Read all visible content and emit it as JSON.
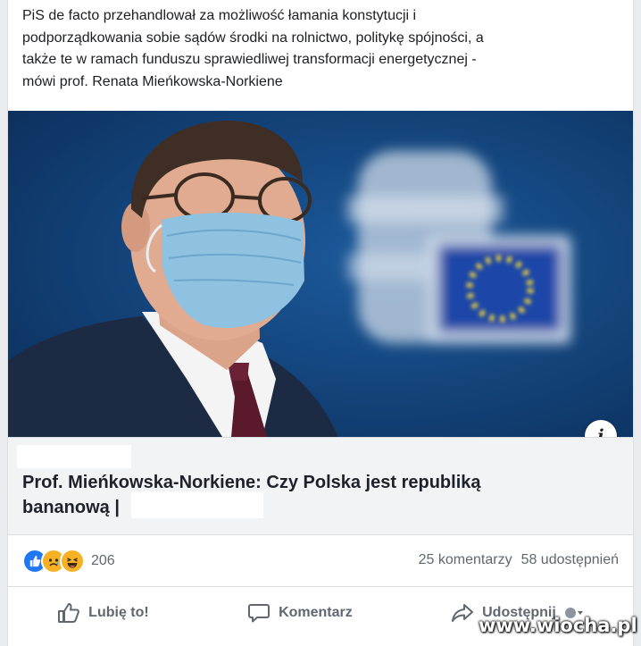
{
  "post": {
    "text_lines": [
      "PiS de facto przehandlował za możliwość łamania konstytucji i",
      "podporządkowania sobie sądów środki na rolnictwo, politykę spójności, a",
      "także te w ramach funduszu sprawiedliwej transformacji energetycznej -",
      "mówi prof. Renata Mieńkowska-Norkiene"
    ]
  },
  "link_preview": {
    "headline_line1": "Prof. Mieńkowska-Norkiene: Czy Polska jest republiką",
    "headline_line2": "bananową |",
    "info_icon": "info-icon"
  },
  "stats": {
    "reactions": [
      "like",
      "sad",
      "haha"
    ],
    "reaction_count": "206",
    "comments": "25 komentarzy",
    "shares": "58 udostępnień"
  },
  "actions": {
    "like_label": "Lubię to!",
    "comment_label": "Komentarz",
    "share_label": "Udostępnij"
  },
  "watermark": "www.wiocha.pl",
  "colors": {
    "facebook_blue": "#2078f4",
    "text_secondary": "#606770",
    "eu_flag": "#1f47a8"
  }
}
